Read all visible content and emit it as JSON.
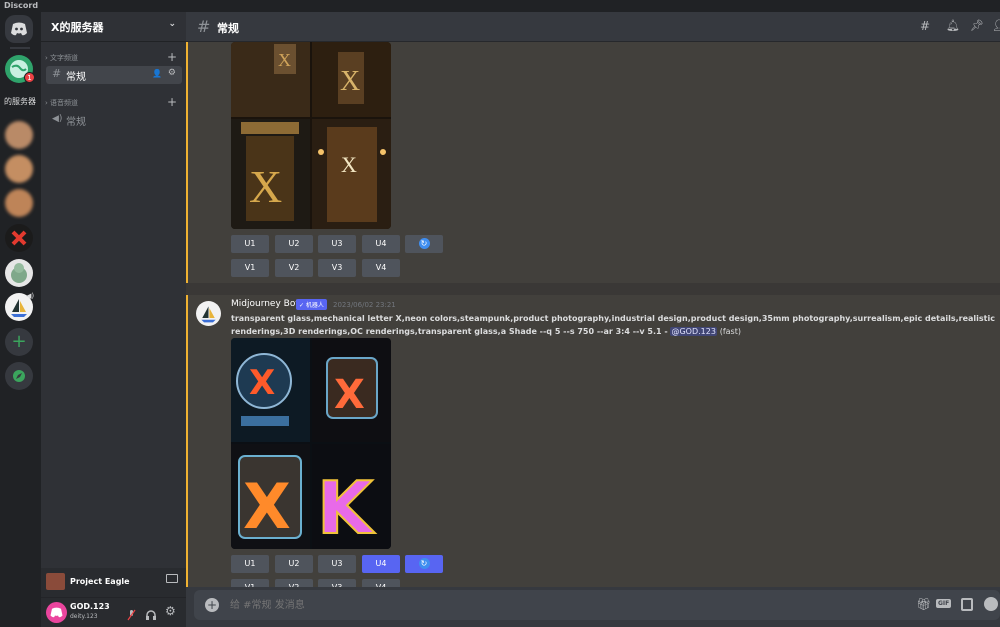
{
  "window": {
    "title": "Discord"
  },
  "server": {
    "name": "X的服务器"
  },
  "rail": {
    "unread_badge": "1",
    "partial_label": "的服务器"
  },
  "channels": {
    "text_category": "文字频道",
    "voice_category": "语音频道",
    "text_channel": "常规",
    "voice_channel": "常规"
  },
  "voice_panel": {
    "label": "Project Eagle"
  },
  "user": {
    "name": "GOD.123",
    "tag": "deity.123"
  },
  "header": {
    "channel": "常规"
  },
  "message": {
    "author": "Midjourney Bot",
    "bot_badge": "✓ 机器人",
    "timestamp": "2023/06/02 23:21",
    "text_line1": "transparent glass,mechanical letter X,neon colors,steampunk,product photography,industrial design,product design,35mm photography,surrealism,epic details,realistic",
    "text_line2": "renderings,3D renderings,OC renderings,transparent glass,a Shade --q 5 --s 750 --ar 3:4 --v 5.1 -",
    "mention": "@GOD.123",
    "suffix": "(fast)"
  },
  "buttons": {
    "u1": "U1",
    "u2": "U2",
    "u3": "U3",
    "u4": "U4",
    "v1": "V1",
    "v2": "V2",
    "v3": "V3",
    "v4": "V4"
  },
  "input": {
    "placeholder": "给 #常规 发消息",
    "gif": "GIF"
  },
  "colors": {
    "accent": "#5865f2",
    "highlight_bar": "#f0b232",
    "mention_bg": "#414675"
  }
}
